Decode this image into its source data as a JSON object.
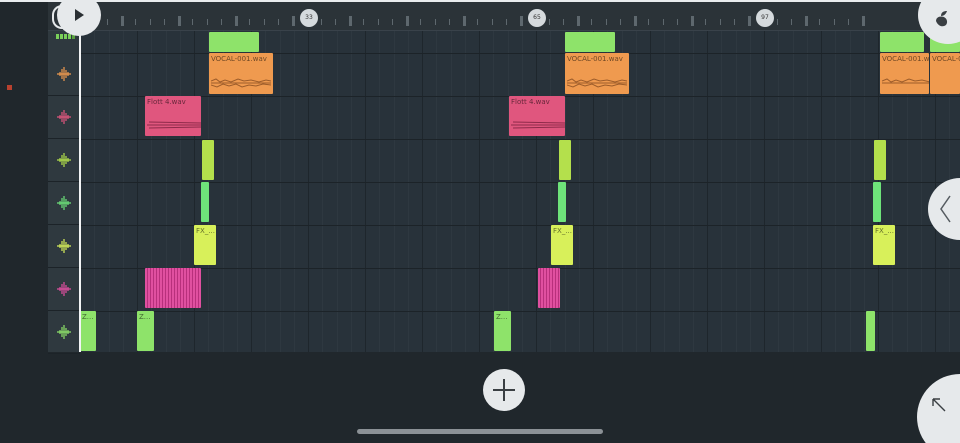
{
  "colors": {
    "background": "#20272c",
    "ruler": "#2b3338",
    "grid": "#28323a",
    "accent_green": "#8ee36a",
    "vocal_orange": "#ef9a4f",
    "flute_pink": "#e0567e",
    "perc_pink": "#e050a0",
    "fx_yellow": "#d8f05a"
  },
  "ruler": {
    "markers": [
      "33",
      "65",
      "97"
    ]
  },
  "track_icons": [
    "waveform-icon",
    "waveform-icon",
    "waveform-icon",
    "waveform-icon",
    "waveform-icon",
    "waveform-icon",
    "waveform-icon"
  ],
  "clips": {
    "vocal": "VOCAL-001.wav",
    "vocal_cut": "VOCAL-001.wav",
    "flute": "Flott 4.wav",
    "fx": "FX_...",
    "z": "Z..."
  },
  "controls": {
    "play": "play-icon",
    "fl_logo": "fruit-logo-icon",
    "side_panel": "chevron-left-icon",
    "add": "plus-icon",
    "expand": "arrow-up-left-icon"
  }
}
